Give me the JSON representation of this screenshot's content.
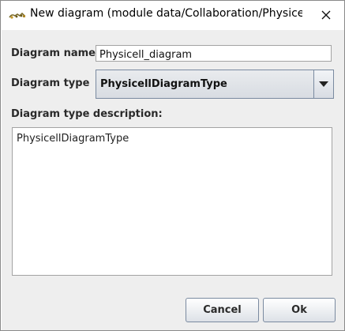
{
  "window": {
    "title": "New diagram (module data/Collaboration/Physicell ...",
    "close_icon": "close-icon",
    "app_icon": "app-logo-icon"
  },
  "form": {
    "name_label": "Diagram name",
    "name_value": "Physicell_diagram",
    "type_label": "Diagram type",
    "type_value": "PhysicellDiagramType",
    "description_label": "Diagram type description:",
    "description_text": "PhysicellDiagramType"
  },
  "buttons": {
    "cancel_label": "Cancel",
    "ok_label": "Ok"
  },
  "colors": {
    "background": "#eeeeee",
    "button_border": "#7a8aa0",
    "combo_gradient_top": "#e9ebee",
    "combo_gradient_bottom": "#d8dce2"
  }
}
